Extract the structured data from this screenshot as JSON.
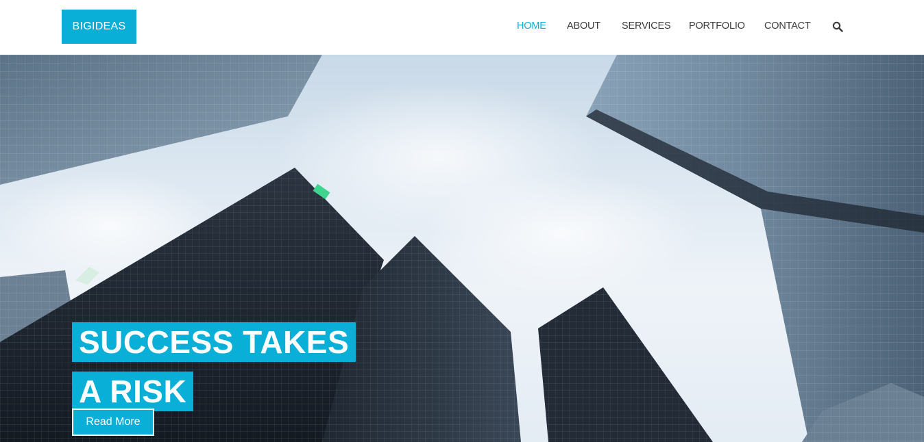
{
  "brand": {
    "logo_text": "BIGIDEAS",
    "accent_color": "#0aafd7"
  },
  "nav": {
    "items": [
      {
        "label": "HOME",
        "active": true
      },
      {
        "label": "ABOUT",
        "active": false
      },
      {
        "label": "SERVICES",
        "active": false
      },
      {
        "label": "PORTFOLIO",
        "active": false
      },
      {
        "label": "CONTACT",
        "active": false
      }
    ],
    "search_icon": "search-icon"
  },
  "hero": {
    "headline_line1": "SUCCESS TAKES",
    "headline_line2": "A RISK",
    "cta_label": "Read More",
    "background": "low-angle view of glass skyscrapers against a cloudy sky"
  }
}
